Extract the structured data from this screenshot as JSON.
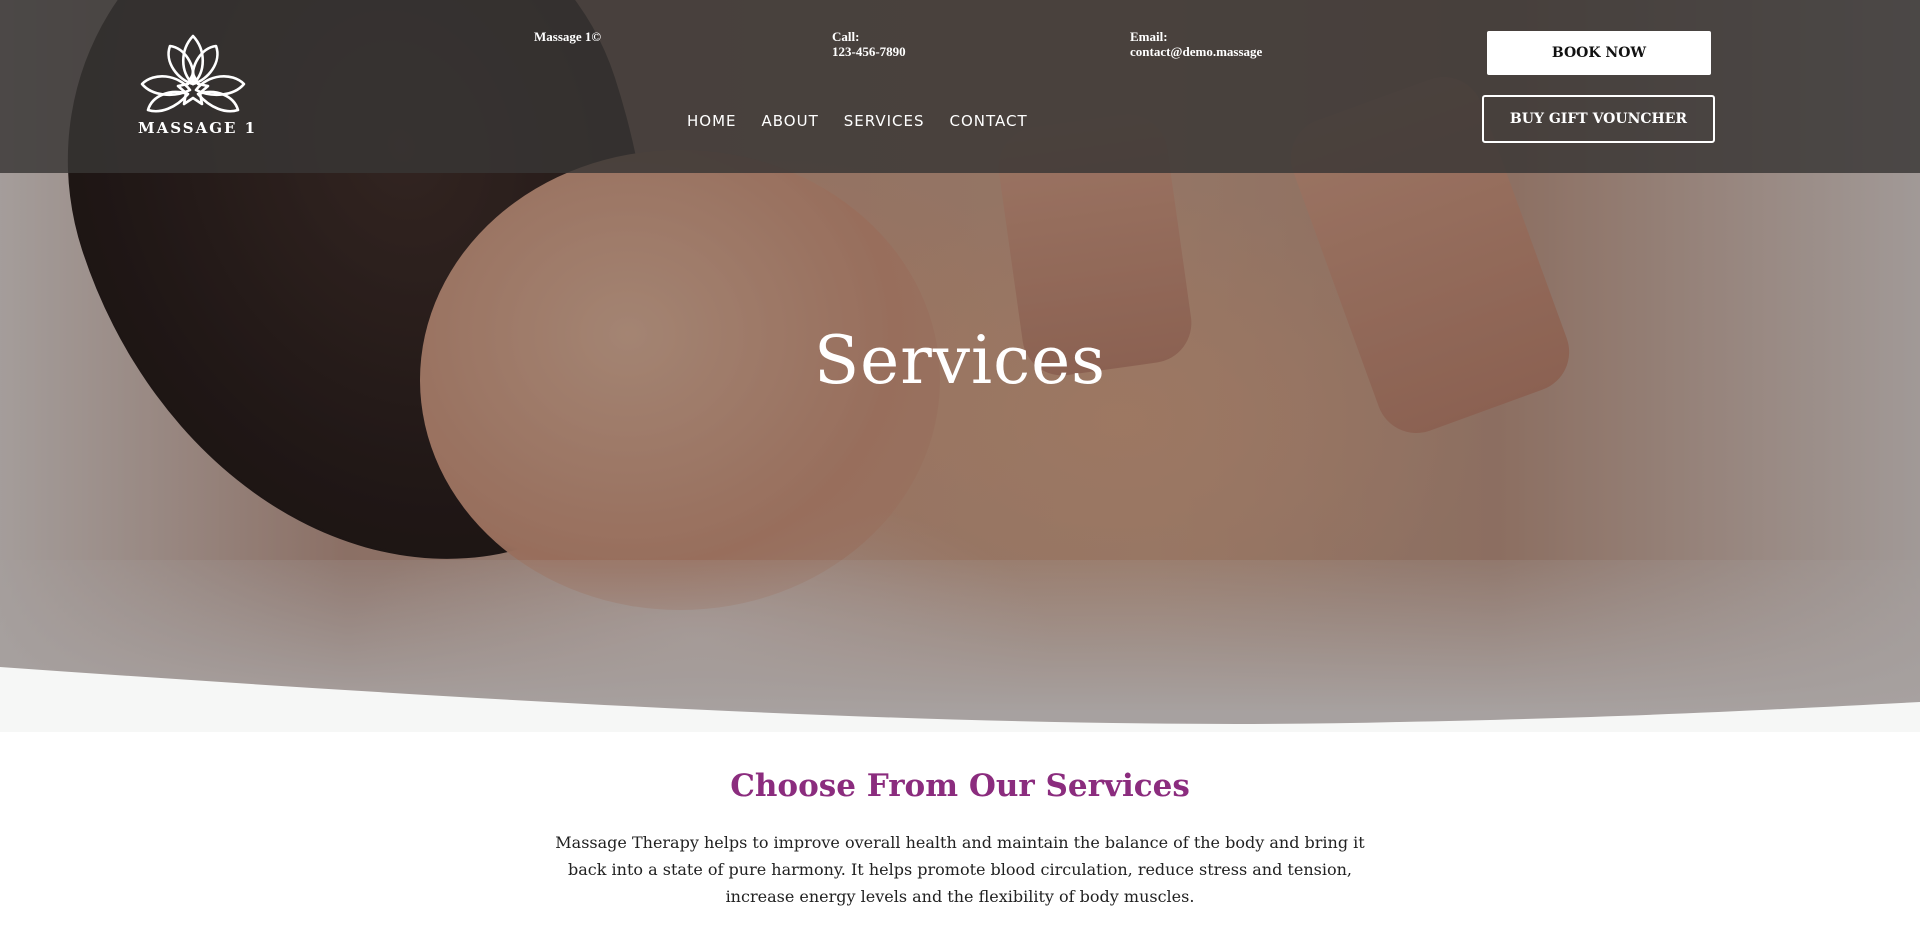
{
  "header": {
    "brand_name": "MASSAGE 1",
    "copyright": "Massage 1©",
    "call_label": "Call:",
    "call_value": "123-456-7890",
    "email_label": "Email:",
    "email_value": "contact@demo.massage",
    "nav": [
      {
        "label": "HOME"
      },
      {
        "label": "ABOUT"
      },
      {
        "label": "SERVICES"
      },
      {
        "label": "CONTACT"
      }
    ],
    "book_label": "BOOK NOW",
    "gift_label": "BUY GIFT VOUNCHER"
  },
  "hero": {
    "title": "Services"
  },
  "section": {
    "title": "Choose From Our Services",
    "text": "Massage Therapy helps to improve overall health and maintain the balance of the body and bring it back into a state of pure harmony. It helps promote blood circulation, reduce stress and tension, increase energy levels and the flexibility of body muscles."
  },
  "colors": {
    "header_bg": "#383635",
    "accent": "#8b2c7e",
    "button_bg": "#ffffff"
  },
  "icons": {
    "logo": "lotus-flower-icon"
  }
}
